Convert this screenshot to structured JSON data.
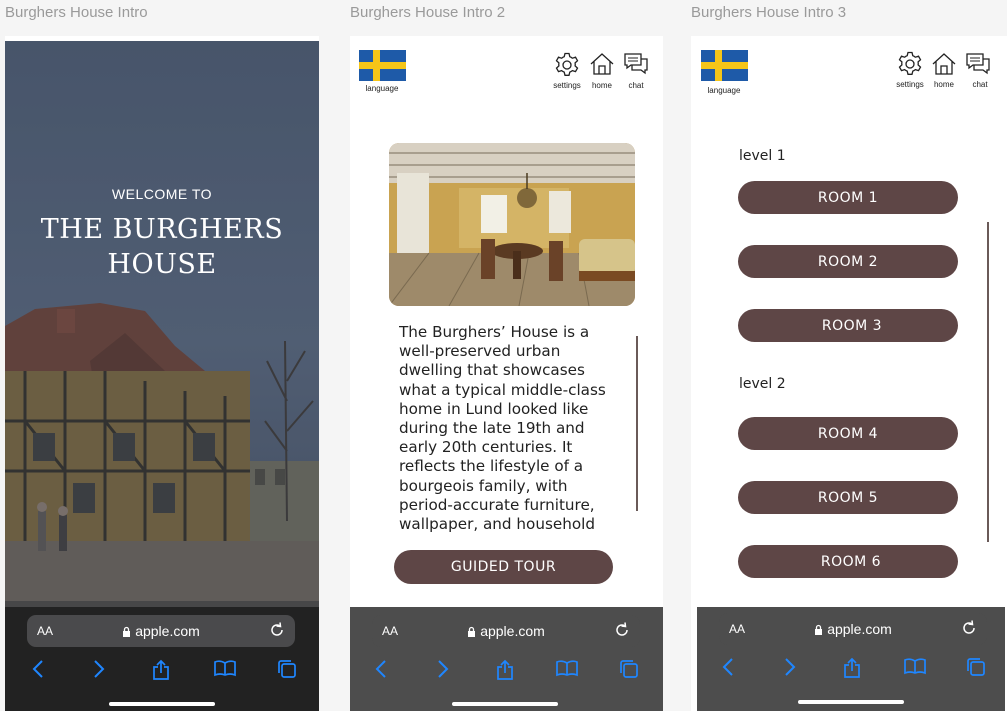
{
  "frames": {
    "intro1": {
      "title": "Burghers House Intro"
    },
    "intro2": {
      "title": "Burghers House Intro 2"
    },
    "intro3": {
      "title": "Burghers House Intro 3"
    }
  },
  "hero": {
    "welcome": "WELCOME TO",
    "title_line1": "THE BURGHERS",
    "title_line2": "HOUSE"
  },
  "header": {
    "language_label": "language",
    "settings_label": "settings",
    "home_label": "home",
    "chat_label": "chat"
  },
  "intro2": {
    "description": "The Burghers’ House is a well-preserved urban dwelling that showcases what a typical middle-class home in Lund looked like during the late 19th and early 20th centuries. It reflects the lifestyle of a bourgeois family, with period-accurate furniture, wallpaper, and household",
    "guided_tour_label": "GUIDED TOUR"
  },
  "intro3": {
    "level1_label": "level 1",
    "level2_label": "level 2",
    "rooms": [
      "ROOM 1",
      "ROOM 2",
      "ROOM 3",
      "ROOM 4",
      "ROOM 5",
      "ROOM 6"
    ]
  },
  "browser": {
    "text_size_label": "AA",
    "url": "apple.com"
  },
  "colors": {
    "button": "#5e4646",
    "browser_dark": "#4d4d4d",
    "safari_blue": "#1f86ff",
    "flag_blue": "#1e5aa8",
    "flag_yellow": "#f5c518"
  }
}
